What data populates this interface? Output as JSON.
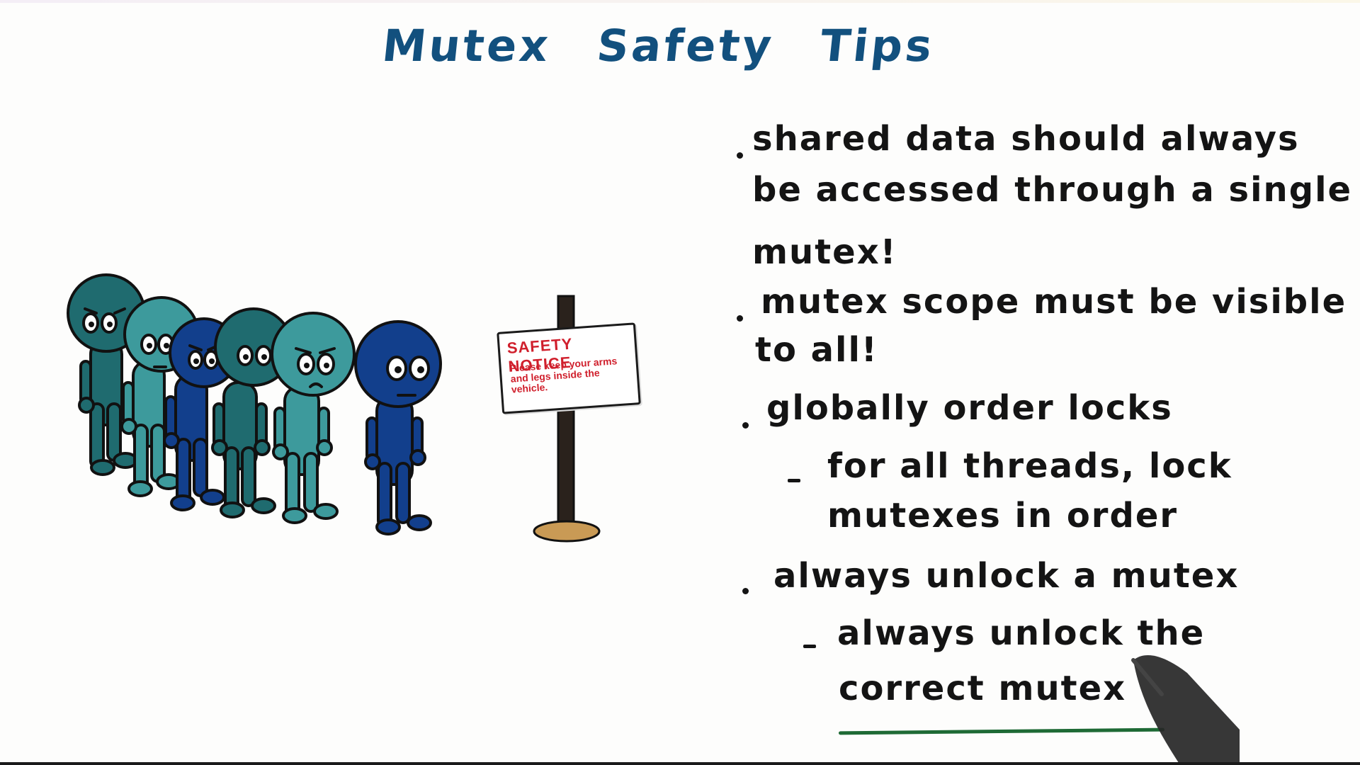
{
  "title": {
    "word1": "Mutex",
    "word2": "Safety",
    "word3": "Tips",
    "color": "#12507e"
  },
  "sign": {
    "heading": "SAFETY NOTICE",
    "body": "Please keep your arms and legs inside the vehicle."
  },
  "tips": {
    "t1_l1": "shared data should always",
    "t1_l2": "be accessed through a single",
    "t1_l3": "mutex!",
    "t2_l1": "mutex scope must be visible",
    "t2_l2": "to all!",
    "t3_l1": "globally order locks",
    "t3_sub_l1": "for all threads, lock",
    "t3_sub_l2": "mutexes in order",
    "t4_l1": "always unlock a mutex",
    "t4_sub_l1": "always unlock the",
    "t4_sub_l2": "correct mutex"
  },
  "colors": {
    "ink": "#141414",
    "teal": "#1f6b6f",
    "teal_light": "#3d9a9c",
    "navy": "#123f8c",
    "sign_red": "#d01f2c",
    "underline": "#1e6a35"
  }
}
